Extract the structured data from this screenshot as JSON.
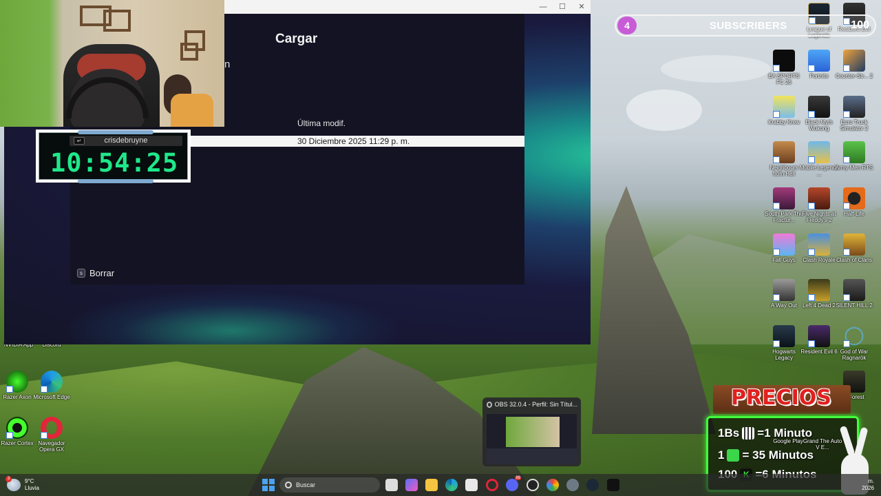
{
  "game": {
    "panel_title": "Cargar",
    "stray_text": "n",
    "column_header": "Última modif.",
    "selected_save": "30 Diciembre 2025 11:29 p. m.",
    "delete_key": "s",
    "delete_label": "Borrar"
  },
  "clock": {
    "username": "crisdebruyne",
    "time": "10:54:25"
  },
  "subscribers": {
    "current": "4",
    "label": "SUBSCRIBERS",
    "goal": "100"
  },
  "desktop_icons": {
    "league": "League of Legends",
    "resident_top": "Resident Evil",
    "fc26": "EA SPORTS FC 26",
    "fortnite": "Fortnite",
    "cs2": "Counter-Str... 2",
    "krabby": "Krabby Krew",
    "wukong": "Black Myth Wukong",
    "euro": "Euro Truck Simulator 2",
    "neighbours": "Neighbours from Hell",
    "mobile": "Mobile Legends ...",
    "army": "Army Men RTS",
    "southpark": "South Park The Fractur...",
    "fnaf": "Five Nights at Freddy's 2",
    "halflife": "Half-Life",
    "fallguys": "Fall Guys",
    "clashroyale": "Clash Royale",
    "clashclans": "Clash of Clans",
    "awayout": "A Way Out",
    "l4d2": "Left 4 Dead 2",
    "silenthill": "SILENT HILL 2",
    "hogwarts": "Hogwarts Legacy",
    "re6": "Resident Evil 6",
    "gow": "God of War Ragnarök",
    "forest": "e Forest",
    "googleplay": "Google Play",
    "gta": "Grand The Auto V E...",
    "nvidia": "NVIDIA App",
    "discord": "Discord",
    "razer_axon": "Razer Axon",
    "edge": "Microsoft Edge",
    "razer_cortex": "Razer Cortex",
    "opera": "Navegador Opera GX"
  },
  "obs": {
    "title": "OBS 32.0.4 - Perfil: Sin Títul..."
  },
  "precios": {
    "title": "PRECIOS",
    "row1": "1Bs",
    "row1_eq": "=1 Minuto",
    "row2": "1",
    "row2_eq": "= 35 Minutos",
    "row3": "100",
    "row3_eq": "=6 Minutos"
  },
  "taskbar": {
    "temperature": "9°C",
    "weather": "Lluvia",
    "weather_badge": "3",
    "search_placeholder": "Buscar",
    "discord_badge": "99",
    "tray_time": "m.",
    "tray_date": "2026"
  },
  "colors": {
    "clock_digits": "#1ee88a",
    "precios_border": "#42ff3c",
    "subs_badge": "#c85bd6"
  }
}
